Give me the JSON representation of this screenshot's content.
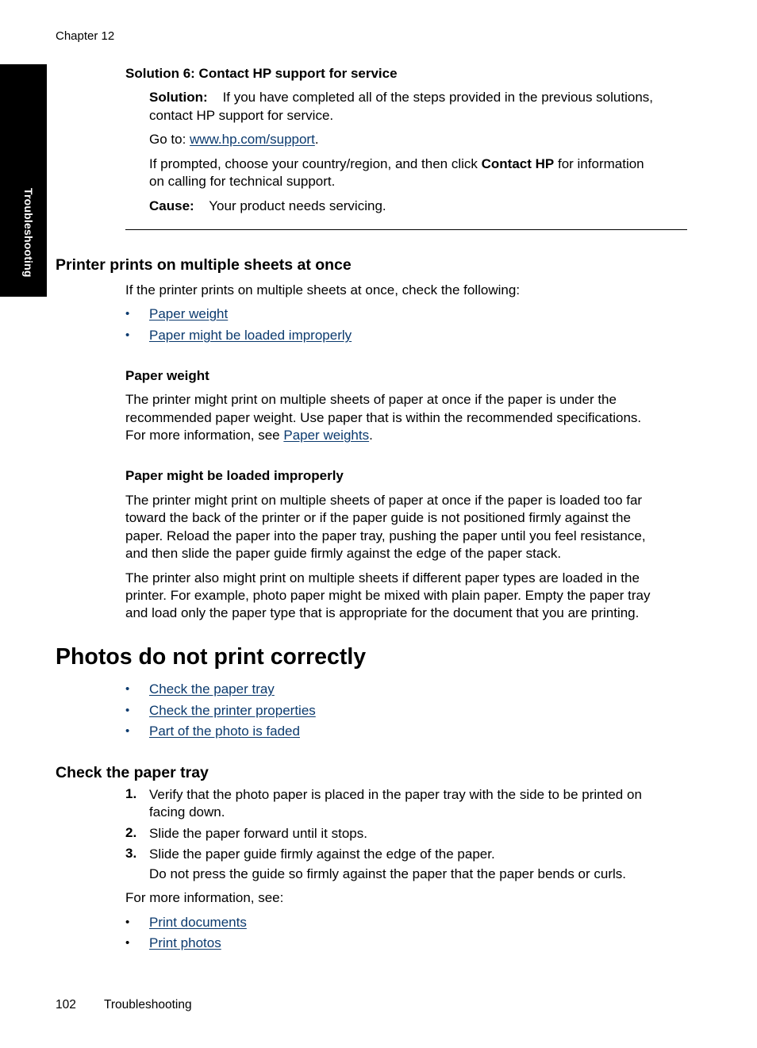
{
  "header": {
    "chapter": "Chapter 12"
  },
  "side_tab": {
    "label": "Troubleshooting"
  },
  "solution6": {
    "title": "Solution 6: Contact HP support for service",
    "solution_label": "Solution:",
    "solution_text": "If you have completed all of the steps provided in the previous solutions,",
    "solution_text_2": "contact HP support for service.",
    "goto_prefix": "Go to: ",
    "goto_link": "www.hp.com/support",
    "goto_suffix": ".",
    "prompt_prefix": "If prompted, choose your country/region, and then click ",
    "prompt_bold": "Contact HP",
    "prompt_suffix": " for information",
    "prompt_line2": "on calling for technical support.",
    "cause_label": "Cause:",
    "cause_text": "Your product needs servicing."
  },
  "multi_sheets": {
    "title": "Printer prints on multiple sheets at once",
    "intro": "If the printer prints on multiple sheets at once, check the following:",
    "links": [
      "Paper weight",
      "Paper might be loaded improperly"
    ],
    "paper_weight": {
      "title": "Paper weight",
      "lines": [
        "The printer might print on multiple sheets of paper at once if the paper is under the",
        "recommended paper weight. Use paper that is within the recommended specifications."
      ],
      "line3_prefix": "For more information, see ",
      "line3_link": "Paper weights",
      "line3_suffix": "."
    },
    "loaded_improperly": {
      "title": "Paper might be loaded improperly",
      "para1": [
        "The printer might print on multiple sheets of paper at once if the paper is loaded too far",
        "toward the back of the printer or if the paper guide is not positioned firmly against the",
        "paper. Reload the paper into the paper tray, pushing the paper until you feel resistance,",
        "and then slide the paper guide firmly against the edge of the paper stack."
      ],
      "para2": [
        "The printer also might print on multiple sheets if different paper types are loaded in the",
        "printer. For example, photo paper might be mixed with plain paper. Empty the paper tray",
        "and load only the paper type that is appropriate for the document that you are printing."
      ]
    }
  },
  "photos": {
    "title": "Photos do not print correctly",
    "links": [
      "Check the paper tray",
      "Check the printer properties",
      "Part of the photo is faded"
    ]
  },
  "paper_tray": {
    "title": "Check the paper tray",
    "steps": [
      {
        "num": "1.",
        "lines": [
          "Verify that the photo paper is placed in the paper tray with the side to be printed on",
          "facing down."
        ]
      },
      {
        "num": "2.",
        "lines": [
          "Slide the paper forward until it stops."
        ]
      },
      {
        "num": "3.",
        "lines": [
          "Slide the paper guide firmly against the edge of the paper."
        ]
      }
    ],
    "step3_note": "Do not press the guide so firmly against the paper that the paper bends or curls.",
    "more_info": "For more information, see:",
    "links": [
      "Print documents",
      "Print photos"
    ]
  },
  "footer": {
    "page_number": "102",
    "section": "Troubleshooting"
  },
  "colors": {
    "link": "#0b3a6e",
    "side_tab_bg": "#000000"
  }
}
